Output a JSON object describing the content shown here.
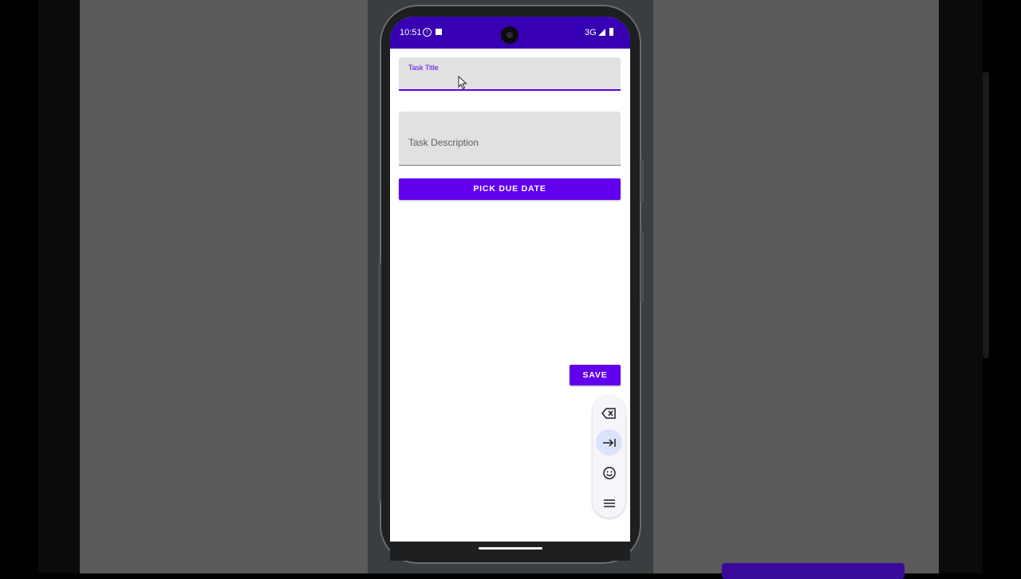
{
  "status_bar": {
    "time": "10:51",
    "network": "3G",
    "color": "#3700b3"
  },
  "form": {
    "title_field": {
      "label": "Task Title",
      "value": ""
    },
    "description_field": {
      "placeholder": "Task Description",
      "value": ""
    },
    "pick_due_date_label": "PICK DUE DATE",
    "save_label": "SAVE"
  },
  "keyboard_toolbar": {
    "icons": [
      "backspace-icon",
      "tab-icon",
      "emoji-icon",
      "menu-icon"
    ]
  },
  "colors": {
    "accent": "#6200ee",
    "primary_dark": "#3700b3"
  }
}
